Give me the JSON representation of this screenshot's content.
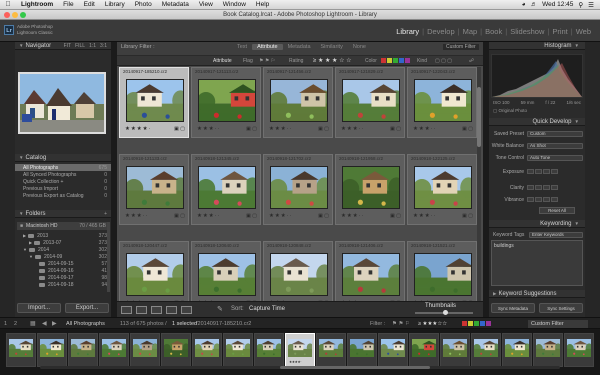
{
  "menubar": {
    "app": "Lightroom",
    "items": [
      "File",
      "Edit",
      "Library",
      "Photo",
      "Metadata",
      "View",
      "Window",
      "Help"
    ],
    "clock": "Wed 12:45"
  },
  "window": {
    "title": "Book Catalog.lrcat - Adobe Photoshop Lightroom - Library"
  },
  "identity": {
    "line1": "Adobe Photoshop",
    "line2": "Lightroom Classic",
    "logo": "Lr"
  },
  "modules": {
    "items": [
      "Library",
      "Develop",
      "Map",
      "Book",
      "Slideshow",
      "Print",
      "Web"
    ],
    "active": "Library"
  },
  "navigator": {
    "title": "Navigator",
    "options": [
      "FIT",
      "FILL",
      "1:1",
      "3:1"
    ]
  },
  "catalog": {
    "title": "Catalog",
    "items": [
      {
        "label": "All Photographs",
        "count": "675",
        "selected": true
      },
      {
        "label": "All Synced Photographs",
        "count": "0"
      },
      {
        "label": "Quick Collection +",
        "count": "0"
      },
      {
        "label": "Previous Import",
        "count": "0"
      },
      {
        "label": "Previous Export as Catalog",
        "count": "0"
      }
    ]
  },
  "folders": {
    "title": "Folders",
    "volume": {
      "name": "Macintosh HD",
      "info": "70 / 465 GB"
    },
    "items": [
      {
        "label": "2013",
        "count": "373",
        "indent": 1
      },
      {
        "label": "2013-07",
        "count": "373",
        "indent": 2
      },
      {
        "label": "2014",
        "count": "302",
        "indent": 1
      },
      {
        "label": "2014-09",
        "count": "302",
        "indent": 2
      },
      {
        "label": "2014-09-15",
        "count": "57",
        "indent": 3
      },
      {
        "label": "2014-09-16",
        "count": "41",
        "indent": 3
      },
      {
        "label": "2014-09-17",
        "count": "98",
        "indent": 3
      },
      {
        "label": "2014-09-18",
        "count": "94",
        "indent": 3
      }
    ]
  },
  "left_buttons": {
    "import": "Import...",
    "export": "Export..."
  },
  "filter": {
    "title": "Library Filter :",
    "tabs": [
      "Text",
      "Attribute",
      "Metadata",
      "Similarity",
      "None"
    ],
    "active_tab": "Attribute",
    "custom": "Custom Filter",
    "attribute_label": "Attribute",
    "flag_label": "Flag",
    "rating_label": "Rating",
    "color_label": "Color",
    "kind_label": "Kind"
  },
  "grid": {
    "cells": [
      {
        "label": "20140917-185210.cr2",
        "stars": "★ ★ ★ ★ ·",
        "selected": true
      },
      {
        "label": "20140917-121113.cr2",
        "stars": "★ ★ ★ · ·"
      },
      {
        "label": "20140917-121456.cr2",
        "stars": "★ ★ ★ · ·"
      },
      {
        "label": "20140917-121829.cr2",
        "stars": "★ ★ ★ · ·"
      },
      {
        "label": "20140917-122043.cr2",
        "stars": "★ ★ ★ · ·"
      },
      {
        "label": "20140918-121133.cr2",
        "stars": "★ ★ ★ · ·"
      },
      {
        "label": "20140918-121345.cr2",
        "stars": "★ ★ ★ · ·"
      },
      {
        "label": "20140918-121702.cr2",
        "stars": "★ ★ ★ · ·"
      },
      {
        "label": "20140918-121958.cr2",
        "stars": "★ ★ ★ · ·"
      },
      {
        "label": "20140918-122125.cr2",
        "stars": "★ ★ ★ · ·"
      },
      {
        "label": "20140918-120447.cr2",
        "stars": "★ ★ ★ · ·"
      },
      {
        "label": "20140918-120640.cr2",
        "stars": "★ ★ ★ · ·"
      },
      {
        "label": "20140918-120848.cr2",
        "stars": "★ ★ ★ · ·"
      },
      {
        "label": "20140918-121406.cr2",
        "stars": "★ ★ ★ · ·"
      },
      {
        "label": "20140918-121521.cr2",
        "stars": "★ ★ ★ · ·"
      }
    ]
  },
  "toolbar": {
    "sort_label": "Sort:",
    "sort_value": "Capture Time",
    "thumbnails_label": "Thumbnails"
  },
  "histogram": {
    "title": "Histogram",
    "iso": "ISO 100",
    "focal": "59 mm",
    "aperture": "f / 22",
    "shutter": "1/6 sec",
    "original": "Original Photo"
  },
  "quick_develop": {
    "title": "Quick Develop",
    "saved_preset": {
      "label": "Saved Preset",
      "value": "Custom"
    },
    "white_balance": {
      "label": "White Balance",
      "value": "As Shot"
    },
    "tone_control": {
      "label": "Tone Control",
      "value": "Auto Tone"
    },
    "sliders": [
      "Exposure",
      "Clarity",
      "Vibrance"
    ],
    "reset": "Reset All"
  },
  "keywording": {
    "title": "Keywording",
    "tags_label": "Keyword Tags",
    "tags_value": "Enter Keywords",
    "keywords": "buildings"
  },
  "keyword_suggestions": {
    "title": "Keyword Suggestions"
  },
  "right_buttons": {
    "sync_metadata": "Sync Metadata",
    "sync_settings": "Sync Settings"
  },
  "filmbar": {
    "page1": "1",
    "page2": "2",
    "source": "All Photographs",
    "status": "113 of 675 photos /",
    "selected_text": "1 selected",
    "selected_file": "/20140917-185210.cr2",
    "filter_label": "Filter :",
    "custom": "Custom Filter"
  },
  "filmstrip": {
    "count": 19,
    "selected_index": 9,
    "stars": "★★★★·"
  }
}
